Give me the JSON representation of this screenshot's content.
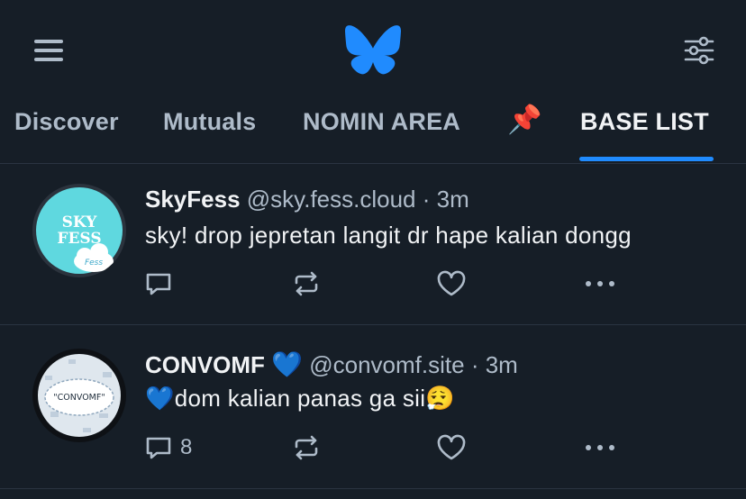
{
  "header": {
    "menu_icon": "hamburger-menu-icon",
    "logo_icon": "butterfly-logo-icon",
    "filter_icon": "feed-settings-icon",
    "brand_color": "#208bfe"
  },
  "tabs": [
    {
      "label": "Discover",
      "active": false
    },
    {
      "label": "Mutuals",
      "active": false
    },
    {
      "label": "NOMIN AREA",
      "active": false
    },
    {
      "label": "📌",
      "active": false
    },
    {
      "label": "BASE LIST",
      "active": true
    }
  ],
  "posts": [
    {
      "author": "SkyFess",
      "handle": "@sky.fess.cloud",
      "separator": "·",
      "time": "3m",
      "text": "sky! drop jepretan langit dr hape kalian dongg",
      "avatar_text_line1": "SKY",
      "avatar_text_line2": "FESS",
      "avatar_badge": "Fess",
      "reply_count": "",
      "repost_count": "",
      "like_count": ""
    },
    {
      "author": "CONVOMF",
      "author_emoji": "💙",
      "handle": "@convomf.site",
      "separator": "·",
      "time": "3m",
      "text_emoji_start": "💙",
      "text": "dom kalian panas ga sii",
      "text_emoji_end": "😮‍💨",
      "avatar_text": "\"CONVOMF\"",
      "reply_count": "8",
      "repost_count": "",
      "like_count": ""
    }
  ]
}
